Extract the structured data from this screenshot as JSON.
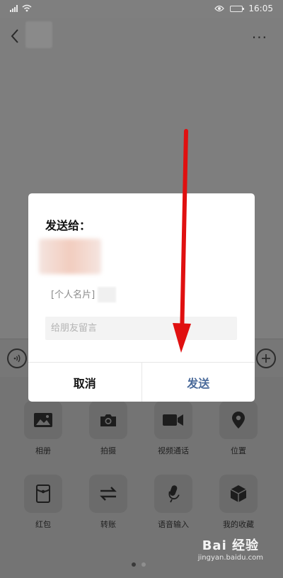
{
  "status_bar": {
    "time": "16:05"
  },
  "topbar": {
    "more": "···"
  },
  "dialog": {
    "title": "发送给：",
    "card_label": "[个人名片]",
    "message_placeholder": "给朋友留言",
    "cancel_label": "取消",
    "send_label": "发送"
  },
  "panel": {
    "items": [
      {
        "label": "相册",
        "icon": "photo-icon"
      },
      {
        "label": "拍摄",
        "icon": "camera-icon"
      },
      {
        "label": "视频通话",
        "icon": "video-icon"
      },
      {
        "label": "位置",
        "icon": "location-icon"
      },
      {
        "label": "红包",
        "icon": "red-packet-icon"
      },
      {
        "label": "转账",
        "icon": "transfer-icon"
      },
      {
        "label": "语音输入",
        "icon": "microphone-icon"
      },
      {
        "label": "我的收藏",
        "icon": "favorites-icon"
      }
    ]
  },
  "watermark": {
    "logo": "Bai 经验",
    "url": "jingyan.baidu.com"
  },
  "colors": {
    "accent_send": "#4a6a9a",
    "arrow": "#e01010"
  }
}
